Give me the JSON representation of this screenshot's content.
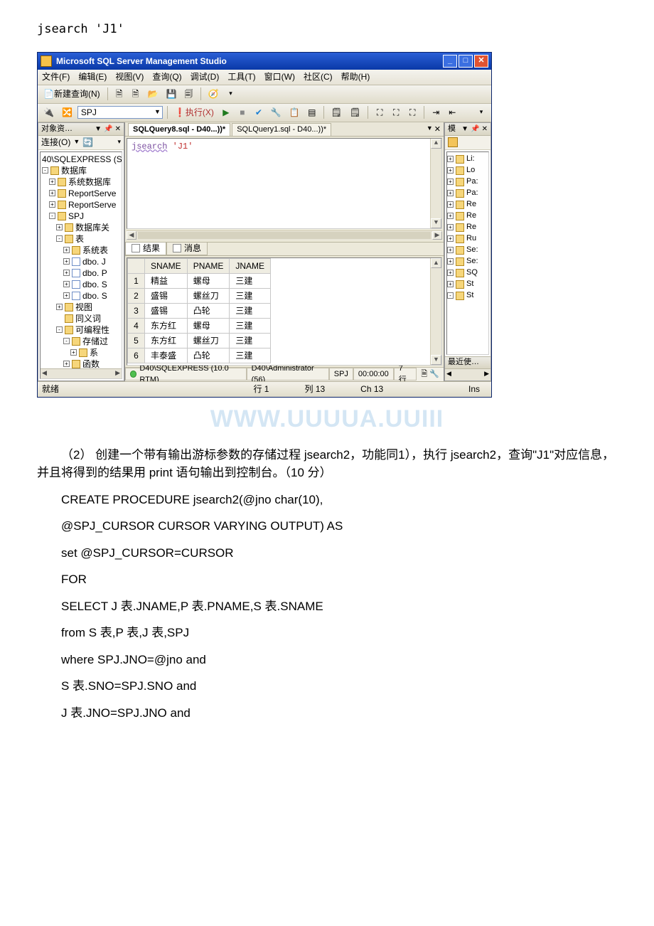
{
  "doc": {
    "top_code": "jsearch 'J1'",
    "para1": "（2）  创建一个带有输出游标参数的存储过程 jsearch2，功能同1），执行 jsearch2，查询\"J1\"对应信息，并且将得到的结果用 print 语句输出到控制台。（10 分）",
    "code_lines": [
      "CREATE PROCEDURE jsearch2(@jno char(10),",
      "@SPJ_CURSOR CURSOR VARYING OUTPUT) AS",
      "set @SPJ_CURSOR=CURSOR",
      "FOR",
      "SELECT J 表.JNAME,P 表.PNAME,S 表.SNAME",
      "from S 表,P 表,J 表,SPJ",
      "where SPJ.JNO=@jno and",
      "S 表.SNO=SPJ.SNO and",
      "J 表.JNO=SPJ.JNO and"
    ],
    "watermark": "WWW.UUUUA.UUIII"
  },
  "window": {
    "title": "Microsoft SQL Server Management Studio",
    "menus": [
      "文件(F)",
      "编辑(E)",
      "视图(V)",
      "查询(Q)",
      "调试(D)",
      "工具(T)",
      "窗口(W)",
      "社区(C)",
      "帮助(H)"
    ],
    "new_query": "新建查询(N)",
    "db_selected": "SPJ",
    "execute": "执行(X)",
    "left_panel": {
      "title": "对象资…",
      "connect": "连接(O)",
      "nodes": [
        {
          "depth": 0,
          "exp": "",
          "icon": "",
          "label": "40\\SQLEXPRESS (S…"
        },
        {
          "depth": 0,
          "exp": "-",
          "icon": "fold",
          "label": "数据库"
        },
        {
          "depth": 1,
          "exp": "+",
          "icon": "fold",
          "label": "系统数据库"
        },
        {
          "depth": 1,
          "exp": "+",
          "icon": "fold",
          "label": "ReportServe"
        },
        {
          "depth": 1,
          "exp": "+",
          "icon": "fold",
          "label": "ReportServe"
        },
        {
          "depth": 1,
          "exp": "-",
          "icon": "fold",
          "label": "SPJ"
        },
        {
          "depth": 2,
          "exp": "+",
          "icon": "fold",
          "label": "数据库关"
        },
        {
          "depth": 2,
          "exp": "-",
          "icon": "fold",
          "label": "表"
        },
        {
          "depth": 3,
          "exp": "+",
          "icon": "fold",
          "label": "系统表"
        },
        {
          "depth": 3,
          "exp": "+",
          "icon": "tbl",
          "label": "dbo. J"
        },
        {
          "depth": 3,
          "exp": "+",
          "icon": "tbl",
          "label": "dbo. P"
        },
        {
          "depth": 3,
          "exp": "+",
          "icon": "tbl",
          "label": "dbo. S"
        },
        {
          "depth": 3,
          "exp": "+",
          "icon": "tbl",
          "label": "dbo. S"
        },
        {
          "depth": 2,
          "exp": "+",
          "icon": "fold",
          "label": "视图"
        },
        {
          "depth": 2,
          "exp": "",
          "icon": "fold",
          "label": "同义词"
        },
        {
          "depth": 2,
          "exp": "-",
          "icon": "fold",
          "label": "可编程性"
        },
        {
          "depth": 3,
          "exp": "-",
          "icon": "fold",
          "label": "存储过"
        },
        {
          "depth": 4,
          "exp": "+",
          "icon": "fold",
          "label": "系"
        },
        {
          "depth": 3,
          "exp": "+",
          "icon": "fold",
          "label": "函数"
        }
      ]
    },
    "tabs": [
      {
        "label": "SQLQuery8.sql - D40...))*",
        "active": true
      },
      {
        "label": "SQLQuery1.sql - D40...))*",
        "active": false
      }
    ],
    "editor_text": {
      "cmd": "jsearch",
      "arg": "'J1'"
    },
    "result_tabs": [
      "结果",
      "消息"
    ],
    "grid": {
      "headers": [
        "",
        "SNAME",
        "PNAME",
        "JNAME"
      ],
      "rows": [
        [
          "1",
          "精益",
          "螺母",
          "三建"
        ],
        [
          "2",
          "盛锡",
          "螺丝刀",
          "三建"
        ],
        [
          "3",
          "盛锡",
          "凸轮",
          "三建"
        ],
        [
          "4",
          "东方红",
          "螺母",
          "三建"
        ],
        [
          "5",
          "东方红",
          "螺丝刀",
          "三建"
        ],
        [
          "6",
          "丰泰盛",
          "凸轮",
          "三建"
        ]
      ]
    },
    "status_q": {
      "server": "D40\\SQLEXPRESS (10.0 RTM)",
      "user": "D40\\Administrator (56)",
      "db": "SPJ",
      "time": "00:00:00",
      "rows": "7 行"
    },
    "right_panel": {
      "title": "模",
      "nodes": [
        "Li:",
        "Lo",
        "Pa:",
        "Pa:",
        "Re",
        "Re",
        "Re",
        "Ru",
        "Se:",
        "Se:",
        "SQ",
        "St",
        "St"
      ],
      "recent": "最近使…"
    },
    "statusbar": {
      "ready": "就绪",
      "line": "行 1",
      "col": "列 13",
      "ch": "Ch 13",
      "ins": "Ins"
    }
  }
}
